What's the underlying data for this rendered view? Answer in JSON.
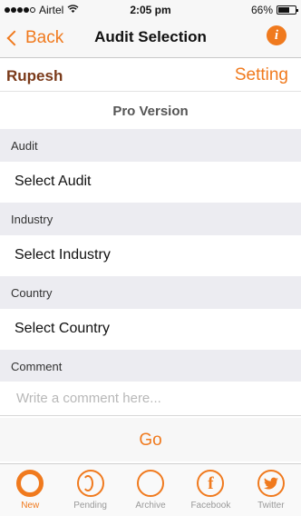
{
  "status_bar": {
    "carrier": "Airtel",
    "time": "2:05 pm",
    "battery": "66%",
    "battery_level": 0.66
  },
  "nav": {
    "back_label": "Back",
    "title": "Audit Selection",
    "info_glyph": "i"
  },
  "user": {
    "name": "Rupesh",
    "setting_label": "Setting"
  },
  "version_label": "Pro Version",
  "sections": {
    "audit": {
      "header": "Audit",
      "value": "Select Audit"
    },
    "industry": {
      "header": "Industry",
      "value": "Select Industry"
    },
    "country": {
      "header": "Country",
      "value": "Select Country"
    },
    "comment": {
      "header": "Comment",
      "placeholder": "Write a comment here..."
    }
  },
  "go_label": "Go",
  "tabs": [
    {
      "label": "New",
      "icon": "new-circle-icon",
      "active": true
    },
    {
      "label": "Pending",
      "icon": "pending-icon",
      "active": false
    },
    {
      "label": "Archive",
      "icon": "archive-icon",
      "active": false
    },
    {
      "label": "Facebook",
      "icon": "facebook-icon",
      "active": false
    },
    {
      "label": "Twitter",
      "icon": "twitter-icon",
      "active": false
    }
  ],
  "colors": {
    "accent": "#f07a1e",
    "username": "#7a3a1a",
    "section_bg": "#ececf1"
  }
}
